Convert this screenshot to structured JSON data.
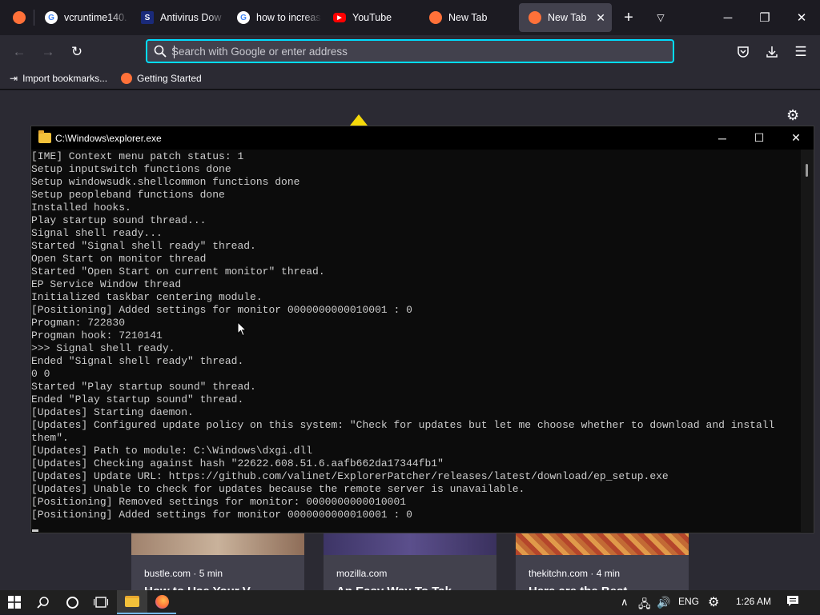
{
  "browser": {
    "tabs": [
      {
        "title": "",
        "favicon": "firefox-icon"
      },
      {
        "title": "vcruntime140.",
        "favicon": "google-icon"
      },
      {
        "title": "Antivirus Dow",
        "favicon": "shield-icon"
      },
      {
        "title": "how to increas",
        "favicon": "google-icon"
      },
      {
        "title": "YouTube",
        "favicon": "youtube-icon"
      },
      {
        "title": "New Tab",
        "favicon": "firefox-icon"
      },
      {
        "title": "New Tab",
        "favicon": "firefox-icon",
        "active": true
      }
    ],
    "address_placeholder": "Search with Google or enter address",
    "bookmarks": [
      {
        "label": "Import bookmarks...",
        "icon": "import-icon"
      },
      {
        "label": "Getting Started",
        "icon": "firefox-icon"
      }
    ]
  },
  "cards": [
    {
      "source": "bustle.com · 5 min",
      "title": "How to Use Your V"
    },
    {
      "source": "mozilla.com",
      "title": "An Easy Way To Tak"
    },
    {
      "source": "thekitchn.com · 4 min",
      "title": "Here are the Best"
    }
  ],
  "console": {
    "title": "C:\\Windows\\explorer.exe",
    "lines": [
      "[IME] Context menu patch status: 1",
      "Setup inputswitch functions done",
      "Setup windowsudk.shellcommon functions done",
      "Setup peopleband functions done",
      "Installed hooks.",
      "Play startup sound thread...",
      "Signal shell ready...",
      "Started \"Signal shell ready\" thread.",
      "Open Start on monitor thread",
      "Started \"Open Start on current monitor\" thread.",
      "EP Service Window thread",
      "Initialized taskbar centering module.",
      "[Positioning] Added settings for monitor 0000000000010001 : 0",
      "Progman: 722830",
      "Progman hook: 7210141",
      ">>> Signal shell ready.",
      "Ended \"Signal shell ready\" thread.",
      "0 0",
      "Started \"Play startup sound\" thread.",
      "Ended \"Play startup sound\" thread.",
      "[Updates] Starting daemon.",
      "[Updates] Configured update policy on this system: \"Check for updates but let me choose whether to download and install",
      "them\".",
      "[Updates] Path to module: C:\\Windows\\dxgi.dll",
      "[Updates] Checking against hash \"22622.608.51.6.aafb662da17344fb1\"",
      "[Updates] Update URL: https://github.com/valinet/ExplorerPatcher/releases/latest/download/ep_setup.exe",
      "[Updates] Unable to check for updates because the remote server is unavailable.",
      "[Positioning] Removed settings for monitor: 0000000000010001",
      "[Positioning] Added settings for monitor 0000000000010001 : 0"
    ]
  },
  "taskbar": {
    "language": "ENG",
    "time": "1:26 AM"
  },
  "colors": {
    "accent": "#00ddff",
    "chrome_dark": "#1c1b22",
    "toolbar": "#2b2a33",
    "console_bg": "#0c0c0c",
    "youtube_red": "#ff0000",
    "firefox_orange": "#ff7139"
  }
}
